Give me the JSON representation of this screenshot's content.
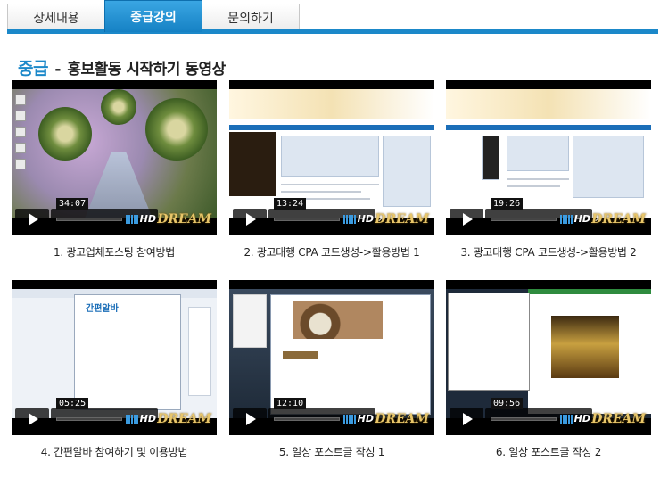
{
  "tabs": [
    {
      "label": "상세내용"
    },
    {
      "label": "중급강의"
    },
    {
      "label": "문의하기"
    }
  ],
  "heading": {
    "level": "중급",
    "dash": "-",
    "title": "홍보활동 시작하기 동영상"
  },
  "videos": [
    {
      "caption": "1. 광고업체포스팅 참여방법",
      "duration": "34:07"
    },
    {
      "caption": "2. 광고대행 CPA 코드생성->활용방법 1",
      "duration": "13:24"
    },
    {
      "caption": "3. 광고대행 CPA 코드생성->활용방법 2",
      "duration": "19:26"
    },
    {
      "caption": "4. 간편알바 참여하기 및 이용방법",
      "duration": "05:25"
    },
    {
      "caption": "5. 일상 포스트글 작성 1",
      "duration": "12:10"
    },
    {
      "caption": "6. 일상 포스트글 작성 2",
      "duration": "09:56"
    }
  ],
  "player": {
    "hd_label": "HD",
    "brand": "DREAM",
    "fullscreen_icon": "fullscreen-icon"
  },
  "ui4": {
    "brand": "간편알바"
  },
  "colors": {
    "accent": "#1b88c9",
    "active_tab": "#1b88c9"
  }
}
